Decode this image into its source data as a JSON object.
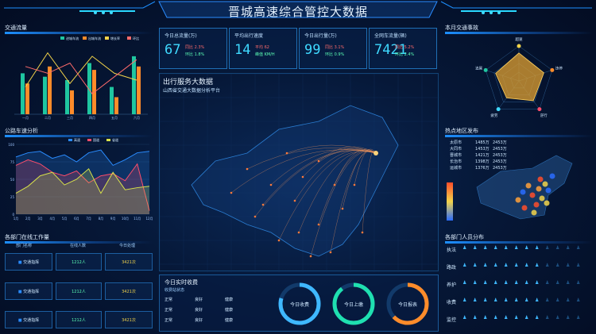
{
  "header": {
    "title": "晋城高速综合管控大数据"
  },
  "panels": {
    "traffic": "交通流量",
    "speed": "公路车速分析",
    "dept": "各部门在线工作量",
    "radar": "本月交通事故",
    "hot": "热点地区发布",
    "staff": "各部门人员分布"
  },
  "kpis": [
    {
      "label": "今日总流量(万)",
      "value": "67",
      "s1": "同比 2.3%",
      "s2": "环比 1.8%"
    },
    {
      "label": "平均出行速度",
      "value": "14",
      "s1": "平均 62",
      "s2": "峰值 KM/H"
    },
    {
      "label": "今日出行量(万)",
      "value": "99",
      "s1": "同比 3.1%",
      "s2": "环比 0.9%"
    },
    {
      "label": "全网车流量(辆)",
      "value": "7421",
      "s1": "同比 5.2%",
      "s2": "环比 2.4%"
    }
  ],
  "map": {
    "title": "出行服务大数据",
    "subtitle": "山西省交通大数据分析平台"
  },
  "dept_table": {
    "headers": [
      "部门名称",
      "在线人数",
      "今日处理"
    ],
    "rows": [
      [
        "交通指挥",
        "1212人",
        "3421次"
      ],
      [
        "交通指挥",
        "1212人",
        "3421次"
      ],
      [
        "交通指挥",
        "1212人",
        "3421次"
      ]
    ]
  },
  "hot_list": [
    [
      "太原市",
      "1485万",
      "2453万"
    ],
    [
      "大同市",
      "1453万",
      "2453万"
    ],
    [
      "晋城市",
      "1421万",
      "2453万"
    ],
    [
      "长治市",
      "1398万",
      "2453万"
    ],
    [
      "运城市",
      "1376万",
      "2453万"
    ]
  ],
  "realtime": {
    "title": "今日实时收费",
    "sub": "收费站状态",
    "rows": [
      [
        "正常",
        "良好",
        "健康"
      ],
      [
        "正常",
        "良好",
        "健康"
      ],
      [
        "正常",
        "良好",
        "健康"
      ]
    ],
    "rings": [
      "今日收费",
      "今日上缴",
      "今日报表"
    ]
  },
  "staff": {
    "rows": [
      "执法",
      "路政",
      "养护",
      "收费",
      "监控"
    ]
  },
  "colors": {
    "accent": "#1d8fff",
    "cyan": "#3fd9ff",
    "green": "#1fc6a0",
    "orange": "#ff8c2a",
    "radar": "#e0a030"
  },
  "chart_data": [
    {
      "type": "bar",
      "title": "交通流量",
      "categories": [
        "一月",
        "二月",
        "三月",
        "四月",
        "五月",
        "六月"
      ],
      "series": [
        {
          "name": "进城车流",
          "values": [
            60,
            55,
            50,
            75,
            40,
            85
          ]
        },
        {
          "name": "出城车流",
          "values": [
            45,
            70,
            35,
            65,
            25,
            70
          ]
        }
      ],
      "lines": [
        {
          "name": "增长率",
          "values": [
            40,
            90,
            45,
            85,
            60,
            50
          ]
        },
        {
          "name": "环比",
          "values": [
            70,
            60,
            75,
            30,
            55,
            80
          ]
        }
      ],
      "ylim": [
        0,
        100
      ]
    },
    {
      "type": "area",
      "title": "公路车速分析",
      "x": [
        "1月",
        "2月",
        "3月",
        "4月",
        "5月",
        "6月",
        "7月",
        "8月",
        "9月",
        "10月",
        "11月",
        "12月"
      ],
      "series": [
        {
          "name": "高速",
          "values": [
            82,
            88,
            90,
            80,
            85,
            75,
            88,
            92,
            70,
            78,
            88,
            90
          ]
        },
        {
          "name": "国道",
          "values": [
            70,
            78,
            72,
            60,
            55,
            62,
            45,
            55,
            58,
            48,
            72,
            5
          ]
        },
        {
          "name": "省道",
          "values": [
            30,
            40,
            55,
            60,
            42,
            50,
            65,
            30,
            60,
            35,
            38,
            40
          ]
        }
      ],
      "ylim": [
        0,
        100
      ]
    },
    {
      "type": "radar",
      "title": "本月交通事故",
      "axes": [
        "超速",
        "违停",
        "逆行",
        "疲劳",
        "追尾"
      ],
      "values": [
        80,
        75,
        70,
        60,
        70
      ],
      "max": 100
    }
  ]
}
